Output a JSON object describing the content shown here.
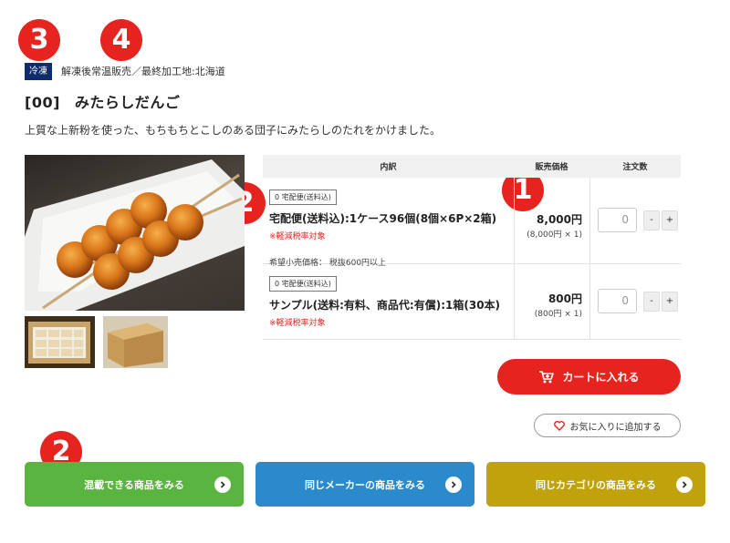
{
  "markers": {
    "m1": "1",
    "m2a": "2",
    "m2b": "2",
    "m3": "3",
    "m4": "4"
  },
  "product": {
    "storage_badge": "冷凍",
    "storage_note": "解凍後常温販売／最終加工地:北海道",
    "code": "[00]",
    "name": "みたらしだんご",
    "description": "上質な上新粉を使った、もちもちとこしのある団子にみたらしのたれをかけました。"
  },
  "table": {
    "headers": {
      "detail": "内訳",
      "price": "販売価格",
      "qty": "注文数"
    },
    "rows": [
      {
        "badge": "0 宅配便(送料込)",
        "name": "宅配便(送料込):1ケース96個(8個×6P×2箱)",
        "reduced_tax": "※軽減税率対象",
        "retail_note": "希望小売価格： 税抜600円以上",
        "price": "8,000円",
        "price_detail": "(8,000円 × 1)",
        "qty_placeholder": "0",
        "minus": "-",
        "plus": "+"
      },
      {
        "badge": "0 宅配便(送料込)",
        "name": "サンプル(送料:有料、商品代:有償):1箱(30本)",
        "reduced_tax": "※軽減税率対象",
        "price": "800円",
        "price_detail": "(800円 × 1)",
        "qty_placeholder": "0",
        "minus": "-",
        "plus": "+"
      }
    ]
  },
  "actions": {
    "cart_label": "カートに入れる",
    "favorite_label": "お気に入りに追加する"
  },
  "nav_buttons": [
    {
      "label": "混載できる商品をみる",
      "color": "#5ab540"
    },
    {
      "label": "同じメーカーの商品をみる",
      "color": "#2b8acb"
    },
    {
      "label": "同じカテゴリの商品をみる",
      "color": "#bfa20c"
    }
  ],
  "colors": {
    "accent_red": "#e52420",
    "badge_navy": "#0f2d6b"
  },
  "icons": {
    "cart": "cart-icon",
    "heart": "heart-icon",
    "arrow": "arrow-right-icon"
  }
}
